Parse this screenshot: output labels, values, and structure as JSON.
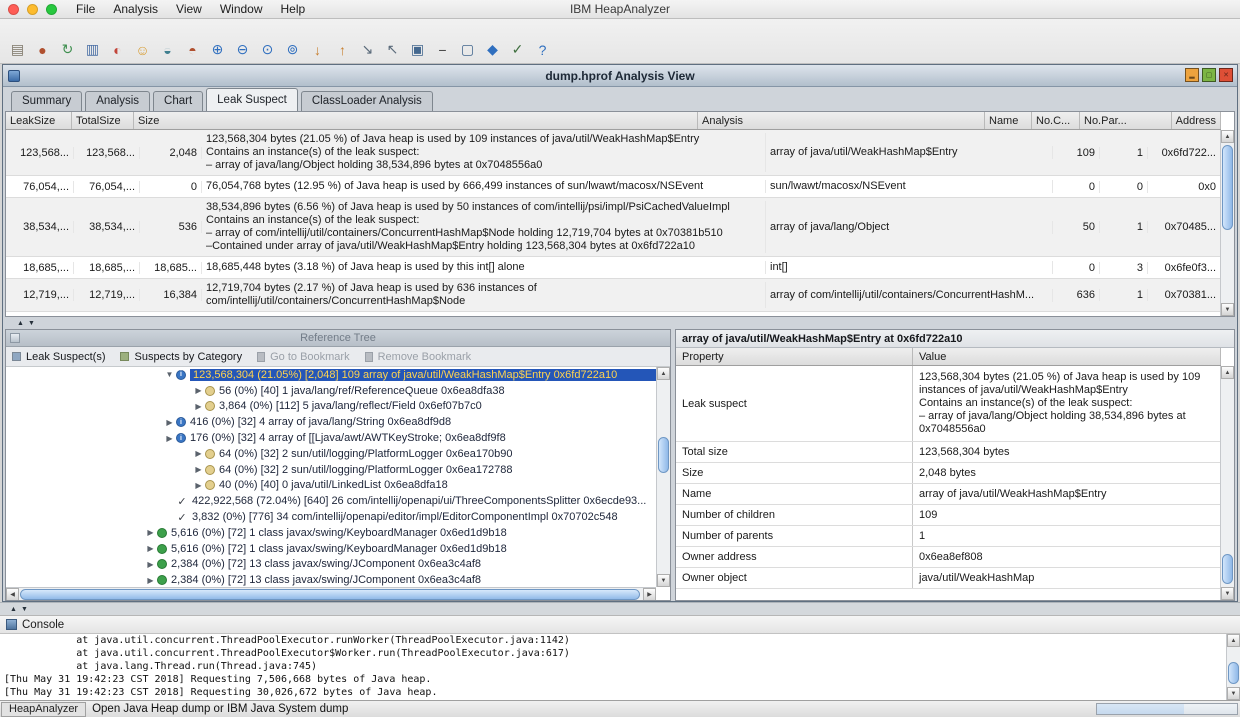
{
  "colors": {
    "selection_bg": "#2456b8",
    "selection_text": "#ffd34f",
    "aqua_thumb": "#8fb8e8"
  },
  "menubar": {
    "traffic_lights": [
      {
        "name": "close-window-button",
        "color": "#ff5d56"
      },
      {
        "name": "minimize-window-button",
        "color": "#fdbc2e"
      },
      {
        "name": "zoom-window-button",
        "color": "#27c83f"
      }
    ],
    "menus": [
      "File",
      "Analysis",
      "View",
      "Window",
      "Help"
    ],
    "app_title": "IBM HeapAnalyzer"
  },
  "toolbar": {
    "icons": [
      {
        "name": "open-file-icon",
        "glyph": "▤",
        "color": "#7d7668"
      },
      {
        "name": "heap-dump-icon",
        "glyph": "●",
        "color": "#b0502f"
      },
      {
        "name": "refresh-icon",
        "glyph": "↻",
        "color": "#3f8f4f"
      },
      {
        "name": "monitor-icon",
        "glyph": "▥",
        "color": "#4a6fa5"
      },
      {
        "name": "alert-icon",
        "glyph": "◐",
        "color": "#c2453a"
      },
      {
        "name": "smiley-icon",
        "glyph": "☺",
        "color": "#d79b2f"
      },
      {
        "name": "teacup-icon",
        "glyph": "◒",
        "color": "#3f7f8f"
      },
      {
        "name": "kettle-icon",
        "glyph": "◓",
        "color": "#b0502f"
      },
      {
        "name": "zoom-in-icon",
        "glyph": "⊕",
        "color": "#2f6fbf"
      },
      {
        "name": "zoom-out-icon",
        "glyph": "⊖",
        "color": "#2f6fbf"
      },
      {
        "name": "zoom-reset-icon",
        "glyph": "⊙",
        "color": "#2f6fbf"
      },
      {
        "name": "zoom-fit-icon",
        "glyph": "⊚",
        "color": "#2f6fbf"
      },
      {
        "name": "sort-descending-icon",
        "glyph": "↓",
        "color": "#c77f2f"
      },
      {
        "name": "sort-ascending-icon",
        "glyph": "↑",
        "color": "#c77f2f"
      },
      {
        "name": "export-icon",
        "glyph": "↘",
        "color": "#5a6a7a"
      },
      {
        "name": "import-icon",
        "glyph": "↖",
        "color": "#5a6a7a"
      },
      {
        "name": "screen-icon",
        "glyph": "▣",
        "color": "#44688f"
      },
      {
        "name": "collapse-icon",
        "glyph": "−",
        "color": "#444444"
      },
      {
        "name": "display-icon",
        "glyph": "▢",
        "color": "#44688f"
      },
      {
        "name": "run-icon",
        "glyph": "◆",
        "color": "#2f6fbf"
      },
      {
        "name": "check-icon",
        "glyph": "✓",
        "color": "#3f6f3f"
      },
      {
        "name": "help-icon",
        "glyph": "?",
        "color": "#2f6fbf"
      }
    ]
  },
  "frame": {
    "title": "dump.hprof Analysis View",
    "controls": [
      {
        "name": "minimize-button",
        "color": "#eda33e",
        "glyph": "▂"
      },
      {
        "name": "maximize-button",
        "color": "#7cb544",
        "glyph": "▢"
      },
      {
        "name": "close-button",
        "color": "#de4f36",
        "glyph": "✕"
      }
    ]
  },
  "tabs": [
    {
      "label": "Summary",
      "cls": "tab"
    },
    {
      "label": "Analysis",
      "cls": "tab"
    },
    {
      "label": "Chart",
      "cls": "tab"
    },
    {
      "label": "Leak Suspect",
      "cls": "tab active"
    },
    {
      "label": "ClassLoader Analysis",
      "cls": "tab"
    }
  ],
  "leak_table": {
    "columns": [
      "LeakSize",
      "TotalSize",
      "Size",
      "Analysis",
      "Name",
      "No.C...",
      "No.Par...",
      "Address"
    ],
    "rows": [
      {
        "leak": "123,568...",
        "total": "123,568...",
        "size": "2,048",
        "analysis": "123,568,304 bytes (21.05 %) of Java heap is used by 109 instances of java/util/WeakHashMap$Entry\nContains an instance(s) of the leak suspect:\n– array of java/lang/Object holding 38,534,896 bytes at 0x7048556a0",
        "name": "array of java/util/WeakHashMap$Entry",
        "children": "109",
        "parents": "1",
        "address": "0x6fd722..."
      },
      {
        "leak": "76,054,...",
        "total": "76,054,...",
        "size": "0",
        "analysis": "76,054,768 bytes (12.95 %) of Java heap is used by 666,499 instances of sun/lwawt/macosx/NSEvent",
        "name": "sun/lwawt/macosx/NSEvent",
        "children": "0",
        "parents": "0",
        "address": "0x0"
      },
      {
        "leak": "38,534,...",
        "total": "38,534,...",
        "size": "536",
        "analysis": "38,534,896 bytes (6.56 %) of Java heap is used by 50 instances of com/intellij/psi/impl/PsiCachedValueImpl\nContains an instance(s) of the leak suspect:\n– array of com/intellij/util/containers/ConcurrentHashMap$Node holding 12,719,704 bytes at 0x70381b510\n–Contained under array of java/util/WeakHashMap$Entry holding 123,568,304 bytes at 0x6fd722a10",
        "name": "array of java/lang/Object",
        "children": "50",
        "parents": "1",
        "address": "0x70485..."
      },
      {
        "leak": "18,685,...",
        "total": "18,685,...",
        "size": "18,685...",
        "analysis": "18,685,448 bytes (3.18 %) of Java heap is used by this int[] alone",
        "name": "int[]",
        "children": "0",
        "parents": "3",
        "address": "0x6fe0f3..."
      },
      {
        "leak": "12,719,...",
        "total": "12,719,...",
        "size": "16,384",
        "analysis": "12,719,704 bytes (2.17 %) of Java heap is used by 636 instances of\ncom/intellij/util/containers/ConcurrentHashMap$Node",
        "name": "array of com/intellij/util/containers/ConcurrentHashM...",
        "children": "636",
        "parents": "1",
        "address": "0x70381..."
      }
    ]
  },
  "reference_tree": {
    "title": "Reference Tree",
    "toolbar": {
      "leak_suspects": "Leak Suspect(s)",
      "suspects_by_category": "Suspects by Category",
      "go_to_bookmark": "Go to Bookmark",
      "remove_bookmark": "Remove Bookmark"
    },
    "rows": [
      {
        "cls": "trow d4 sel",
        "arrow": "▼",
        "icon_cls": "tico info",
        "icon_glyph": "i",
        "text": "123,568,304 (21.05%) [2,048] 109 array of java/util/WeakHashMap$Entry 0x6fd722a10"
      },
      {
        "cls": "trow d5",
        "arrow": "▶",
        "icon_cls": "tico dot",
        "icon_glyph": "",
        "text": "56 (0%) [40] 1 java/lang/ref/ReferenceQueue 0x6ea8dfa38"
      },
      {
        "cls": "trow d5",
        "arrow": "▶",
        "icon_cls": "tico dot",
        "icon_glyph": "",
        "text": "3,864 (0%) [112] 5 java/lang/reflect/Field 0x6ef07b7c0"
      },
      {
        "cls": "trow d4",
        "arrow": "▶",
        "icon_cls": "tico info",
        "icon_glyph": "i",
        "text": "416 (0%) [32] 4 array of java/lang/String 0x6ea8df9d8"
      },
      {
        "cls": "trow d4",
        "arrow": "▶",
        "icon_cls": "tico info",
        "icon_glyph": "i",
        "text": "176 (0%) [32] 4 array of [[Ljava/awt/AWTKeyStroke; 0x6ea8df9f8"
      },
      {
        "cls": "trow d5",
        "arrow": "▶",
        "icon_cls": "tico dot",
        "icon_glyph": "",
        "text": "64 (0%) [32] 2 sun/util/logging/PlatformLogger 0x6ea170b90"
      },
      {
        "cls": "trow d5",
        "arrow": "▶",
        "icon_cls": "tico dot",
        "icon_glyph": "",
        "text": "64 (0%) [32] 2 sun/util/logging/PlatformLogger 0x6ea172788"
      },
      {
        "cls": "trow d5",
        "arrow": "▶",
        "icon_cls": "tico dot",
        "icon_glyph": "",
        "text": "40 (0%) [40] 0 java/util/LinkedList 0x6ea8dfa18"
      },
      {
        "cls": "trow d4",
        "arrow": "",
        "icon_cls": "tico check",
        "icon_glyph": "✓",
        "text": "422,922,568 (72.04%) [640] 26 com/intellij/openapi/ui/ThreeComponentsSplitter 0x6ecde93..."
      },
      {
        "cls": "trow d4",
        "arrow": "",
        "icon_cls": "tico check",
        "icon_glyph": "✓",
        "text": "3,832 (0%) [776] 34 com/intellij/openapi/editor/impl/EditorComponentImpl 0x70702c548"
      },
      {
        "cls": "trow d3",
        "arrow": "▶",
        "icon_cls": "tico green",
        "icon_glyph": "",
        "text": "5,616 (0%) [72] 1 class javax/swing/KeyboardManager 0x6ed1d9b18"
      },
      {
        "cls": "trow d3",
        "arrow": "▶",
        "icon_cls": "tico green",
        "icon_glyph": "",
        "text": "5,616 (0%) [72] 1 class javax/swing/KeyboardManager 0x6ed1d9b18"
      },
      {
        "cls": "trow d3",
        "arrow": "▶",
        "icon_cls": "tico green",
        "icon_glyph": "",
        "text": "2,384 (0%) [72] 13 class javax/swing/JComponent 0x6ea3c4af8"
      },
      {
        "cls": "trow d3",
        "arrow": "▶",
        "icon_cls": "tico green",
        "icon_glyph": "",
        "text": "2,384 (0%) [72] 13 class javax/swing/JComponent 0x6ea3c4af8"
      }
    ]
  },
  "details": {
    "header": "array of java/util/WeakHashMap$Entry at 0x6fd722a10",
    "columns": [
      "Property",
      "Value"
    ],
    "rows": [
      {
        "cls": "dpr tall",
        "property": "Leak suspect",
        "value": "123,568,304 bytes (21.05 %) of Java heap is used by 109 instances of java/util/WeakHashMap$Entry\nContains an instance(s) of the leak suspect:\n– array of java/lang/Object holding 38,534,896 bytes at 0x7048556a0"
      },
      {
        "cls": "dpr",
        "property": "Total size",
        "value": "123,568,304 bytes"
      },
      {
        "cls": "dpr",
        "property": "Size",
        "value": "2,048 bytes"
      },
      {
        "cls": "dpr",
        "property": "Name",
        "value": "array of java/util/WeakHashMap$Entry"
      },
      {
        "cls": "dpr",
        "property": "Number of children",
        "value": "109"
      },
      {
        "cls": "dpr",
        "property": "Number of parents",
        "value": "1"
      },
      {
        "cls": "dpr",
        "property": "Owner address",
        "value": "0x6ea8ef808"
      },
      {
        "cls": "dpr",
        "property": "Owner object",
        "value": "java/util/WeakHashMap"
      }
    ]
  },
  "console": {
    "title": "Console",
    "lines": [
      "            at java.util.concurrent.ThreadPoolExecutor.runWorker(ThreadPoolExecutor.java:1142)",
      "            at java.util.concurrent.ThreadPoolExecutor$Worker.run(ThreadPoolExecutor.java:617)",
      "            at java.lang.Thread.run(Thread.java:745)",
      "[Thu May 31 19:42:23 CST 2018] Requesting 7,506,668 bytes of Java heap.",
      "[Thu May 31 19:42:23 CST 2018] Requesting 30,026,672 bytes of Java heap."
    ]
  },
  "statusbar": {
    "app_label": "HeapAnalyzer",
    "message": "Open Java Heap dump or IBM Java System dump"
  }
}
